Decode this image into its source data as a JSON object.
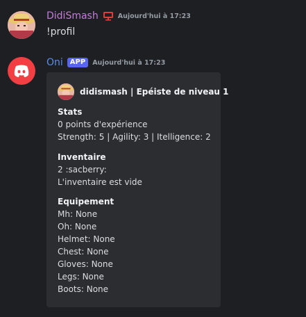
{
  "message1": {
    "username": "DidiSmash",
    "username_color": "#c37ddb",
    "badge_icon": "monitor-icon",
    "timestamp": "Aujourd'hui à 17:23",
    "content": "!profil"
  },
  "message2": {
    "username": "Oni",
    "username_color": "#5a8ee8",
    "badge": "APP",
    "timestamp": "Aujourd'hui à 17:23",
    "avatar_icon": "discord-logo-icon",
    "embed": {
      "author": "didismash | Epéiste de niveau 1",
      "fields": [
        {
          "title": "Stats",
          "lines": [
            "0 points d'expérience",
            "Strength: 5 | Agility: 3 | Itelligence: 2"
          ]
        },
        {
          "title": "Inventaire",
          "lines": [
            "2 :sacberry:",
            "L'inventaire est vide"
          ]
        },
        {
          "title": "Equipement",
          "lines": [
            "Mh: None",
            "Oh: None",
            "Helmet: None",
            "Chest: None",
            "Gloves: None",
            "Legs: None",
            "Boots: None"
          ]
        }
      ]
    }
  },
  "colors": {
    "background": "#1e1f22",
    "embed_background": "#2b2d31",
    "badge_background": "#5865f2",
    "monitor_icon": "#e23b3b",
    "bot_avatar": "#f23f43"
  }
}
